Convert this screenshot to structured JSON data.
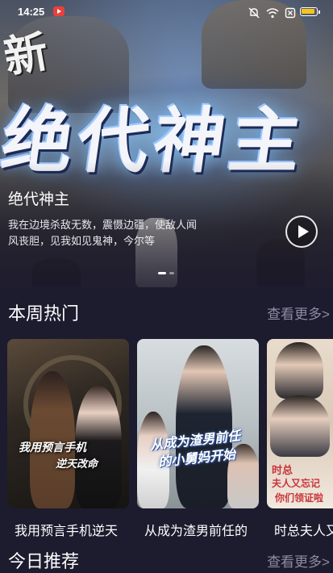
{
  "status_bar": {
    "time": "14:25"
  },
  "hero": {
    "badge": "新",
    "art_title": "绝代神主",
    "title": "绝代神主",
    "description": "我在边境杀敌无数，震慑边疆，使敌人闻风丧胆，见我如见鬼神，今尔等"
  },
  "weekly_hot": {
    "title": "本周热门",
    "more": "查看更多>",
    "items": [
      {
        "caption": "我用预言手机逆天",
        "poster_text": [
          "我用预言手机",
          "逆天改命"
        ]
      },
      {
        "caption": "从成为渣男前任的",
        "poster_text": [
          "从成为渣男前任",
          "的小舅妈开始"
        ]
      },
      {
        "caption": "时总夫人又忘记",
        "poster_text": [
          "时总",
          "夫人又忘记",
          "你们领证啦"
        ]
      }
    ]
  },
  "today_recommend": {
    "title": "今日推荐",
    "more": "查看更多>"
  },
  "colors": {
    "background": "#1d1b2e",
    "muted_text": "#8d8ba0",
    "record_badge": "#e8413a",
    "battery": "#f5c518"
  }
}
